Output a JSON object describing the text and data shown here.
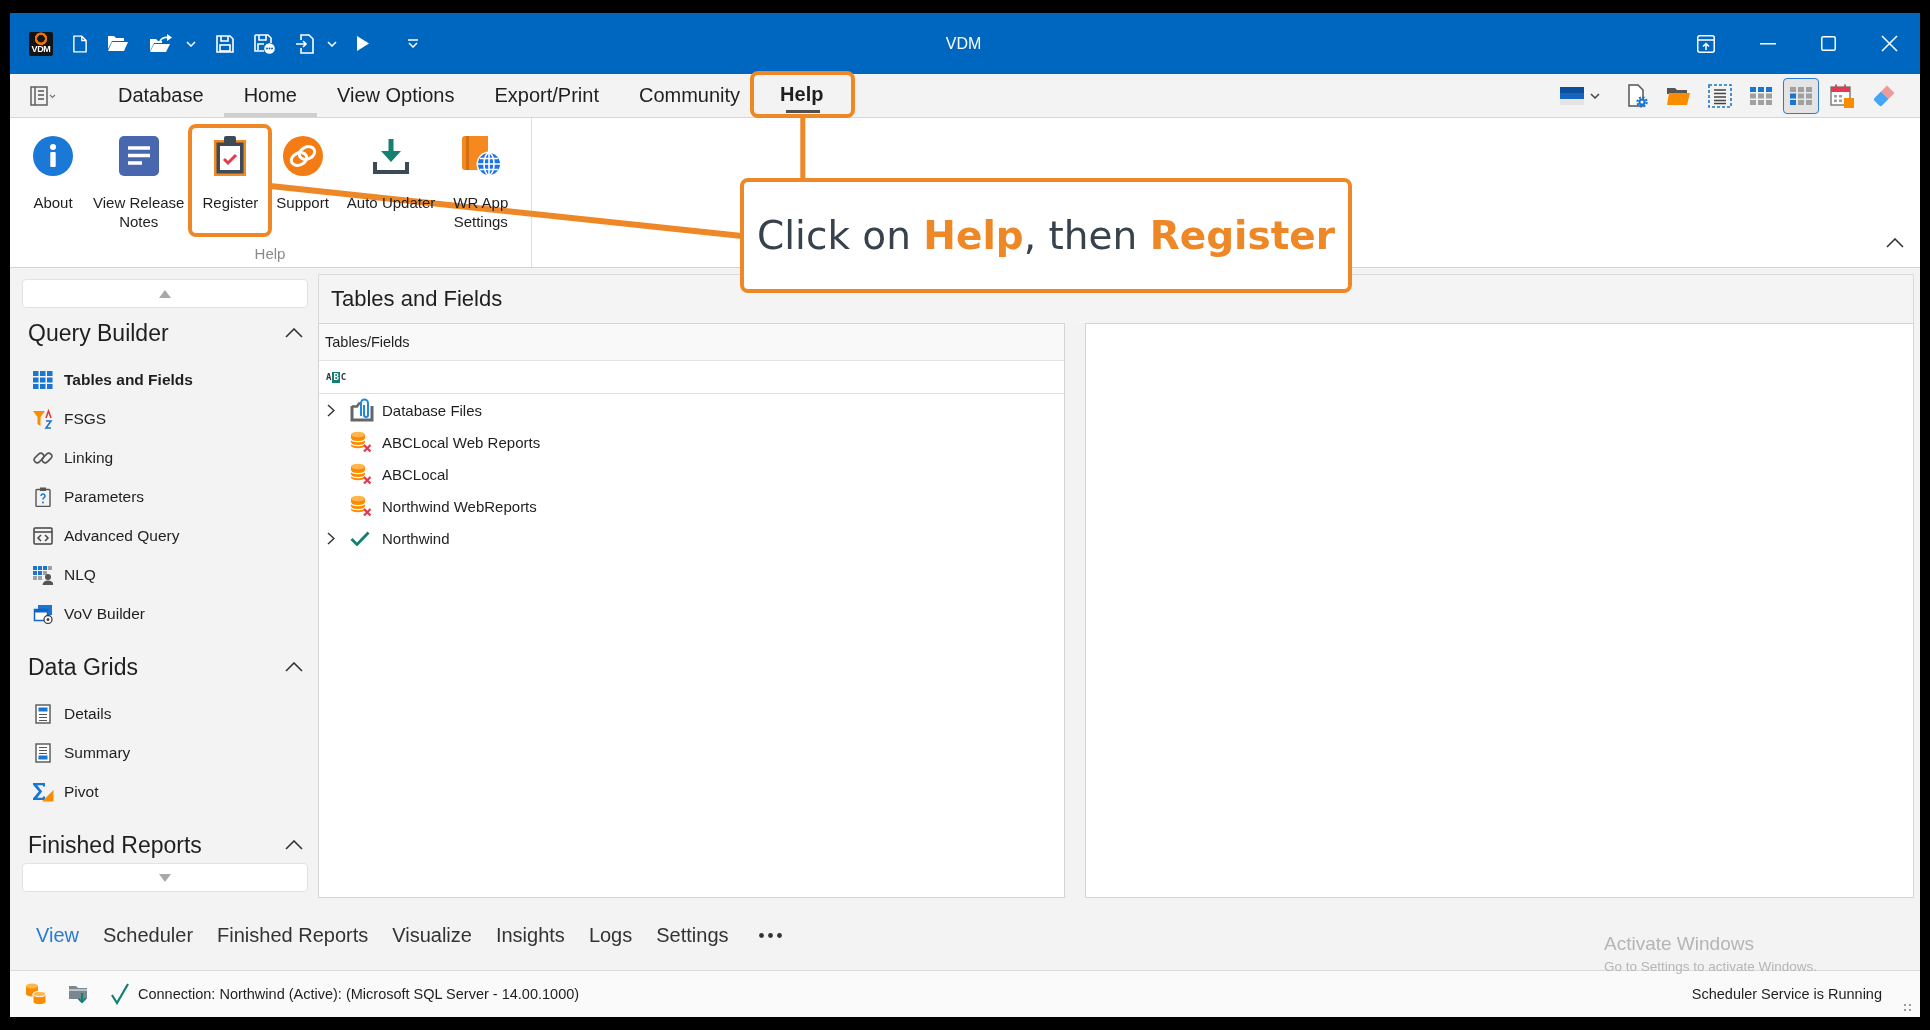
{
  "window": {
    "logo": "VDM",
    "title": "VDM"
  },
  "menu_tabs": [
    {
      "label": "Database",
      "selected": false,
      "hovered": false,
      "highlighted": false
    },
    {
      "label": "Home",
      "selected": false,
      "hovered": true,
      "highlighted": false
    },
    {
      "label": "View Options",
      "selected": false,
      "hovered": false,
      "highlighted": false
    },
    {
      "label": "Export/Print",
      "selected": false,
      "hovered": false,
      "highlighted": false
    },
    {
      "label": "Community",
      "selected": false,
      "hovered": false,
      "highlighted": false
    },
    {
      "label": "Help",
      "selected": true,
      "hovered": false,
      "highlighted": true
    }
  ],
  "view_toolbar": [
    {
      "selected": false
    },
    {
      "selected": false
    },
    {
      "selected": false
    },
    {
      "selected": false
    },
    {
      "selected": true
    },
    {
      "selected": false
    },
    {
      "selected": false
    }
  ],
  "ribbon": {
    "groups": [
      {
        "label": "Help",
        "buttons": [
          {
            "label": "About",
            "highlighted": false
          },
          {
            "label": "View Release\nNotes",
            "highlighted": false
          },
          {
            "label": "Register",
            "highlighted": true
          },
          {
            "label": "Support",
            "highlighted": false
          },
          {
            "label": "Auto Updater",
            "highlighted": false
          },
          {
            "label": "WR App\nSettings",
            "highlighted": false
          }
        ]
      }
    ]
  },
  "sidebar": {
    "sections": [
      {
        "title": "Query Builder",
        "expanded": true,
        "items": [
          {
            "label": "Tables and Fields",
            "selected": true
          },
          {
            "label": "FSGS",
            "selected": false
          },
          {
            "label": "Linking",
            "selected": false
          },
          {
            "label": "Parameters",
            "selected": false
          },
          {
            "label": "Advanced Query",
            "selected": false
          },
          {
            "label": "NLQ",
            "selected": false
          },
          {
            "label": "VoV Builder",
            "selected": false
          }
        ]
      },
      {
        "title": "Data Grids",
        "expanded": true,
        "items": [
          {
            "label": "Details",
            "selected": false
          },
          {
            "label": "Summary",
            "selected": false
          },
          {
            "label": "Pivot",
            "selected": false
          }
        ]
      },
      {
        "title": "Finished Reports",
        "expanded": true
      }
    ]
  },
  "panel": {
    "title": "Tables and Fields"
  },
  "tree": {
    "column": "Tables/Fields",
    "toolbar_button": "ABC",
    "items": [
      {
        "label": "Database Files",
        "kind": "folder",
        "expandable": true,
        "expanded": false,
        "selected": false
      },
      {
        "label": "ABCLocal Web Reports",
        "kind": "datasource",
        "connected": false,
        "expandable": false,
        "selected": false
      },
      {
        "label": "ABCLocal",
        "kind": "datasource",
        "connected": false,
        "expandable": false,
        "selected": false
      },
      {
        "label": "Northwind WebReports",
        "kind": "datasource",
        "connected": false,
        "expandable": false,
        "selected": false
      },
      {
        "label": "Northwind",
        "kind": "datasource",
        "connected": true,
        "expandable": true,
        "expanded": false,
        "selected": false
      }
    ]
  },
  "bottom_tabs": [
    {
      "label": "View",
      "selected": true
    },
    {
      "label": "Scheduler",
      "selected": false
    },
    {
      "label": "Finished Reports",
      "selected": false
    },
    {
      "label": "Visualize",
      "selected": false
    },
    {
      "label": "Insights",
      "selected": false
    },
    {
      "label": "Logs",
      "selected": false
    },
    {
      "label": "Settings",
      "selected": false
    }
  ],
  "status_bar": {
    "connected": true,
    "connection": "Connection: Northwind (Active): (Microsoft SQL Server - 14.00.1000)",
    "scheduler": "Scheduler Service is Running"
  },
  "annotation": {
    "callout": "Click on **Help**, then **Register**"
  },
  "os_watermark": {
    "title": "Activate Windows",
    "subtitle": "Go to Settings to activate Windows."
  }
}
